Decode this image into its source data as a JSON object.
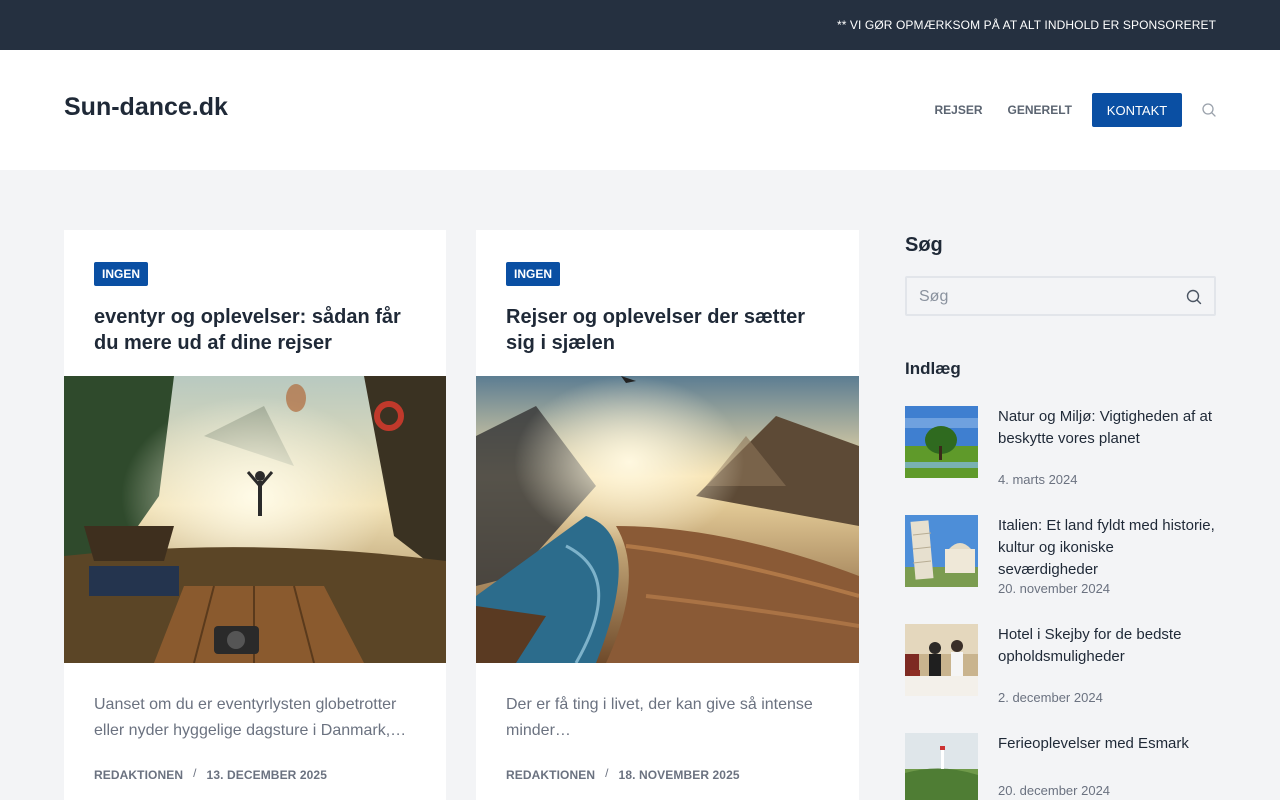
{
  "topbar": {
    "notice": "** VI GØR OPMÆRKSOM PÅ AT ALT INDHOLD ER SPONSORERET"
  },
  "header": {
    "site_title": "Sun-dance.dk",
    "nav": {
      "items": [
        "REJSER",
        "GENERELT"
      ],
      "cta": "KONTAKT"
    }
  },
  "colors": {
    "accent": "#0a4fa3",
    "topbar": "#253040",
    "background": "#f3f4f6"
  },
  "posts": [
    {
      "category": "INGEN",
      "title": "eventyr og oplevelser: sådan får du mere ud af dine rejser",
      "excerpt": "Uanset om du er eventyrlysten globetrotter eller nyder hyggelige dagsture i Danmark,…",
      "author": "REDAKTIONEN",
      "date": "13. DECEMBER 2025"
    },
    {
      "category": "INGEN",
      "title": "Rejser og oplevelser der sætter sig i sjælen",
      "excerpt": "Der er få ting i livet, der kan give så intense minder…",
      "author": "REDAKTIONEN",
      "date": "18. NOVEMBER 2025"
    }
  ],
  "sidebar": {
    "search_title": "Søg",
    "search_placeholder": "Søg",
    "posts_title": "Indlæg",
    "recent": [
      {
        "title": "Natur og Miljø: Vigtigheden af at beskytte vores planet",
        "date": "4. marts 2024"
      },
      {
        "title": "Italien: Et land fyldt med historie, kultur og ikoniske seværdigheder",
        "date": "20. november 2024"
      },
      {
        "title": "Hotel i Skejby for de bedste opholdsmuligheder",
        "date": "2. december 2024"
      },
      {
        "title": "Ferieoplevelser med Esmark",
        "date": "20. december 2024"
      }
    ]
  },
  "icons": {
    "header_search": "search-icon",
    "sidebar_search": "search-icon"
  }
}
